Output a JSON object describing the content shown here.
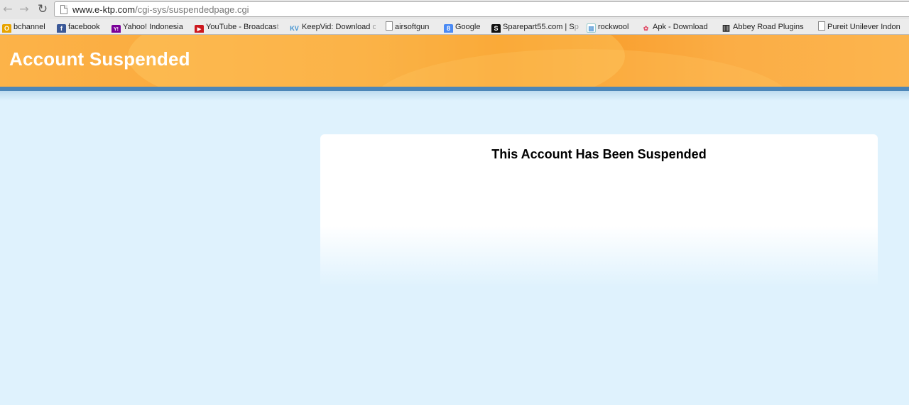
{
  "browser": {
    "url_host": "www.e-ktp.com",
    "url_path": "/cgi-sys/suspendedpage.cgi",
    "nav": {
      "back": "←",
      "forward": "→",
      "reload": "↻"
    }
  },
  "bookmarks": [
    {
      "label": "bchannel",
      "icon": "bchannel-icon",
      "color": "#e8a400",
      "glyph": "O"
    },
    {
      "label": "facebook",
      "icon": "facebook-icon",
      "color": "#3b5998",
      "glyph": "f"
    },
    {
      "label": "Yahoo! Indonesia",
      "icon": "yahoo-icon",
      "color": "#7b0099",
      "glyph": "Y!"
    },
    {
      "label": "YouTube - Broadcas",
      "label_fade": "t",
      "icon": "youtube-icon",
      "color": "#cc181e",
      "glyph": "▶"
    },
    {
      "label": "KeepVid: Download",
      "label_fade": " o",
      "icon": "keepvid-icon",
      "color": "#3a8fd0",
      "glyph": "KV"
    },
    {
      "label": "airsoftgun",
      "icon": "page-icon",
      "color": "#ffffff",
      "glyph": ""
    },
    {
      "label": "Google",
      "icon": "google-icon",
      "color": "#4a8af4",
      "glyph": "8"
    },
    {
      "label": "Sparepart55.com | S",
      "label_fade": "p",
      "icon": "sparepart-icon",
      "color": "#111111",
      "glyph": "S"
    },
    {
      "label": "rockwool",
      "icon": "rockwool-icon",
      "color": "#6fa8dc",
      "glyph": "▦"
    },
    {
      "label": "Apk - Download",
      "icon": "apk-icon",
      "color": "#ffffff",
      "glyph": "✿"
    },
    {
      "label": "Abbey Road Plugins",
      "icon": "abbey-road-icon",
      "color": "#ffffff",
      "glyph": "▥"
    },
    {
      "label": "Pureit Unilever Indon",
      "icon": "page-icon",
      "color": "#ffffff",
      "glyph": ""
    }
  ],
  "banner": {
    "title": "Account Suspended"
  },
  "card": {
    "title": "This Account Has Been Suspended"
  }
}
